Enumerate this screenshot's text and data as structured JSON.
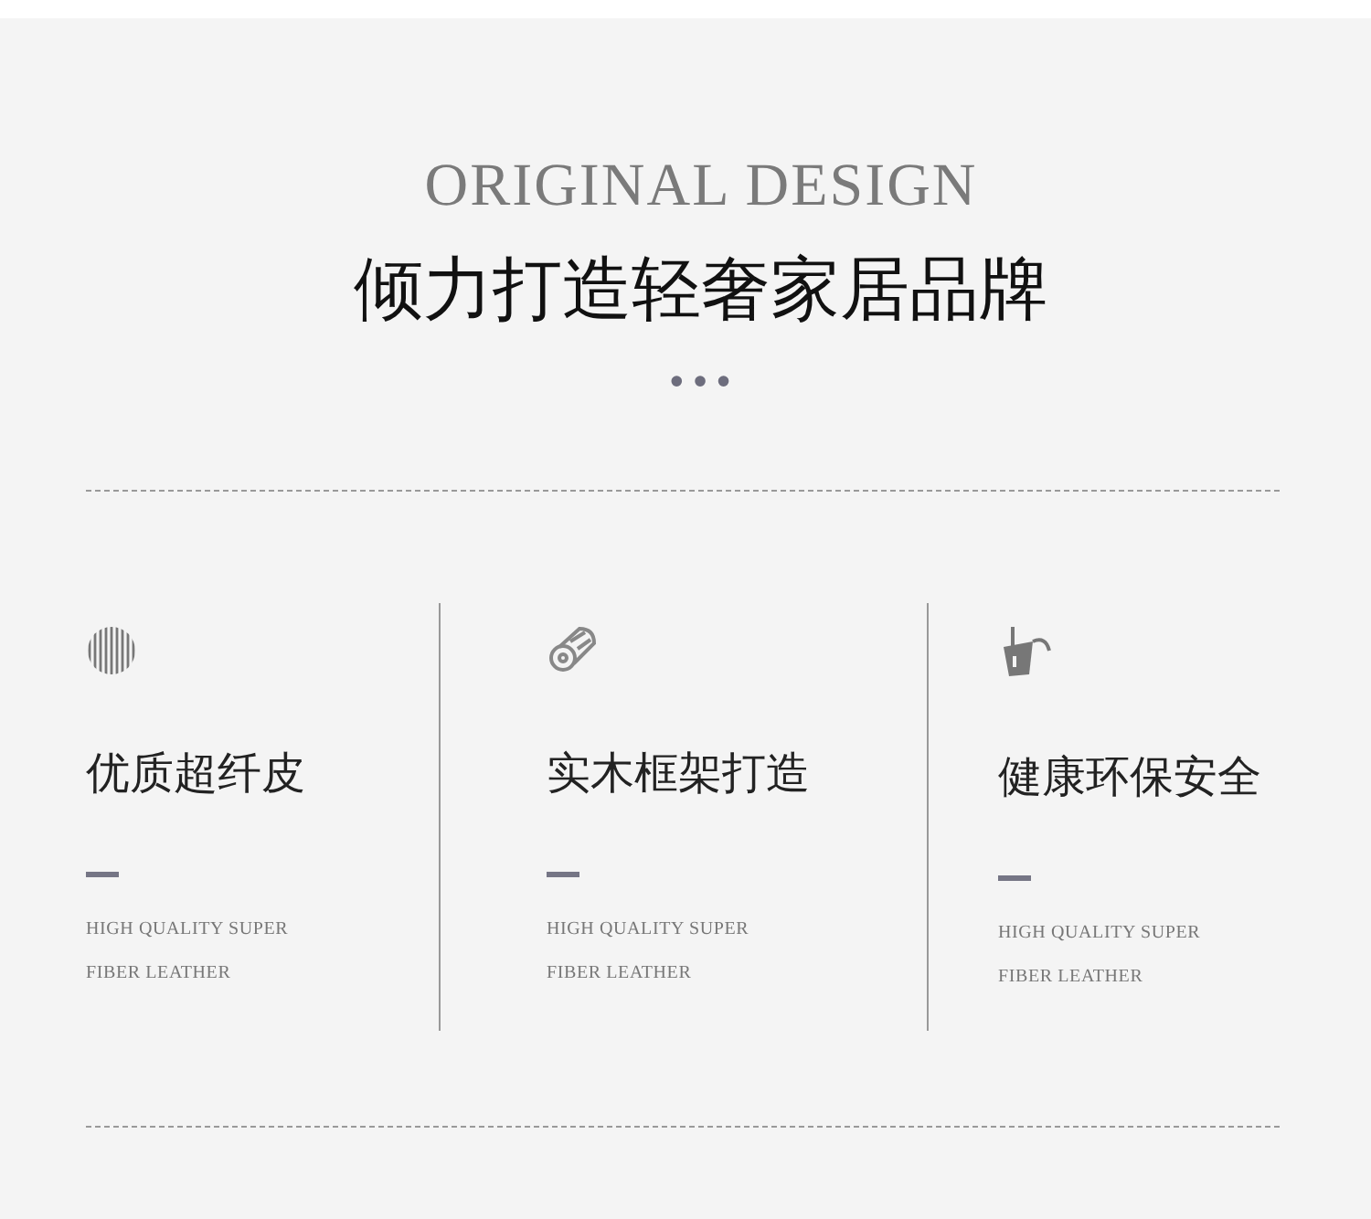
{
  "header": {
    "subtitle": "ORIGINAL DESIGN",
    "title": "倾力打造轻奢家居品牌",
    "dots": "•••"
  },
  "features": [
    {
      "kind": "stripes",
      "title": "优质超纤皮",
      "lines": [
        "HIGH QUALITY SUPER",
        "FIBER LEATHER"
      ]
    },
    {
      "kind": "wood",
      "title": "实木框架打造",
      "lines": [
        "HIGH QUALITY SUPER",
        "FIBER LEATHER"
      ]
    },
    {
      "kind": "bucket",
      "title": "健康环保安全",
      "lines": [
        "HIGH QUALITY SUPER",
        "FIBER LEATHER"
      ]
    }
  ]
}
